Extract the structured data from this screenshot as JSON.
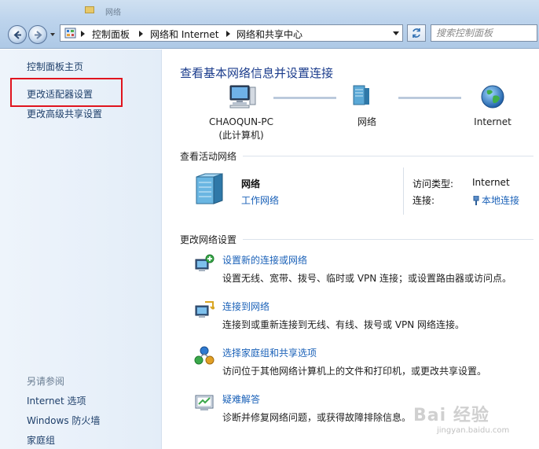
{
  "window": {
    "partial_title": "网络"
  },
  "address_bar": {
    "crumbs": [
      "控制面板",
      "网络和 Internet",
      "网络和共享中心"
    ],
    "search_placeholder": "搜索控制面板"
  },
  "left_pane": {
    "links": [
      "控制面板主页",
      "更改适配器设置",
      "更改高级共享设置"
    ],
    "highlighted_link": "更改适配器设置",
    "highlight_color": "#e0141e",
    "see_also_heading": "另请参阅",
    "see_also_links": [
      "Internet 选项",
      "Windows 防火墙",
      "家庭组"
    ]
  },
  "main": {
    "title": "查看基本网络信息并设置连接",
    "network_map": {
      "computer_name": "CHAOQUN-PC",
      "computer_note": "(此计算机)",
      "network_label": "网络",
      "internet_label": "Internet"
    },
    "active_networks": {
      "heading": "查看活动网络",
      "network_name": "网络",
      "network_type": "工作网络",
      "access_type_label": "访问类型:",
      "access_type_value": "Internet",
      "connection_label": "连接:",
      "connection_value": "本地连接"
    },
    "change_settings": {
      "heading": "更改网络设置",
      "tasks": [
        {
          "title": "设置新的连接或网络",
          "description": "设置无线、宽带、拨号、临时或 VPN 连接；或设置路由器或访问点。",
          "icon": "new-connection-icon"
        },
        {
          "title": "连接到网络",
          "description": "连接到或重新连接到无线、有线、拨号或 VPN 网络连接。",
          "icon": "connect-network-icon"
        },
        {
          "title": "选择家庭组和共享选项",
          "description": "访问位于其他网络计算机上的文件和打印机，或更改共享设置。",
          "icon": "homegroup-icon"
        },
        {
          "title": "疑难解答",
          "description": "诊断并修复网络问题，或获得故障排除信息。",
          "icon": "troubleshoot-icon"
        }
      ]
    }
  },
  "watermark": {
    "text": "Bai 经验",
    "url": "jingyan.baidu.com"
  },
  "colors": {
    "link": "#1a61b8",
    "title": "#1b3c8c",
    "left_pane_link": "#1e3f6a"
  }
}
